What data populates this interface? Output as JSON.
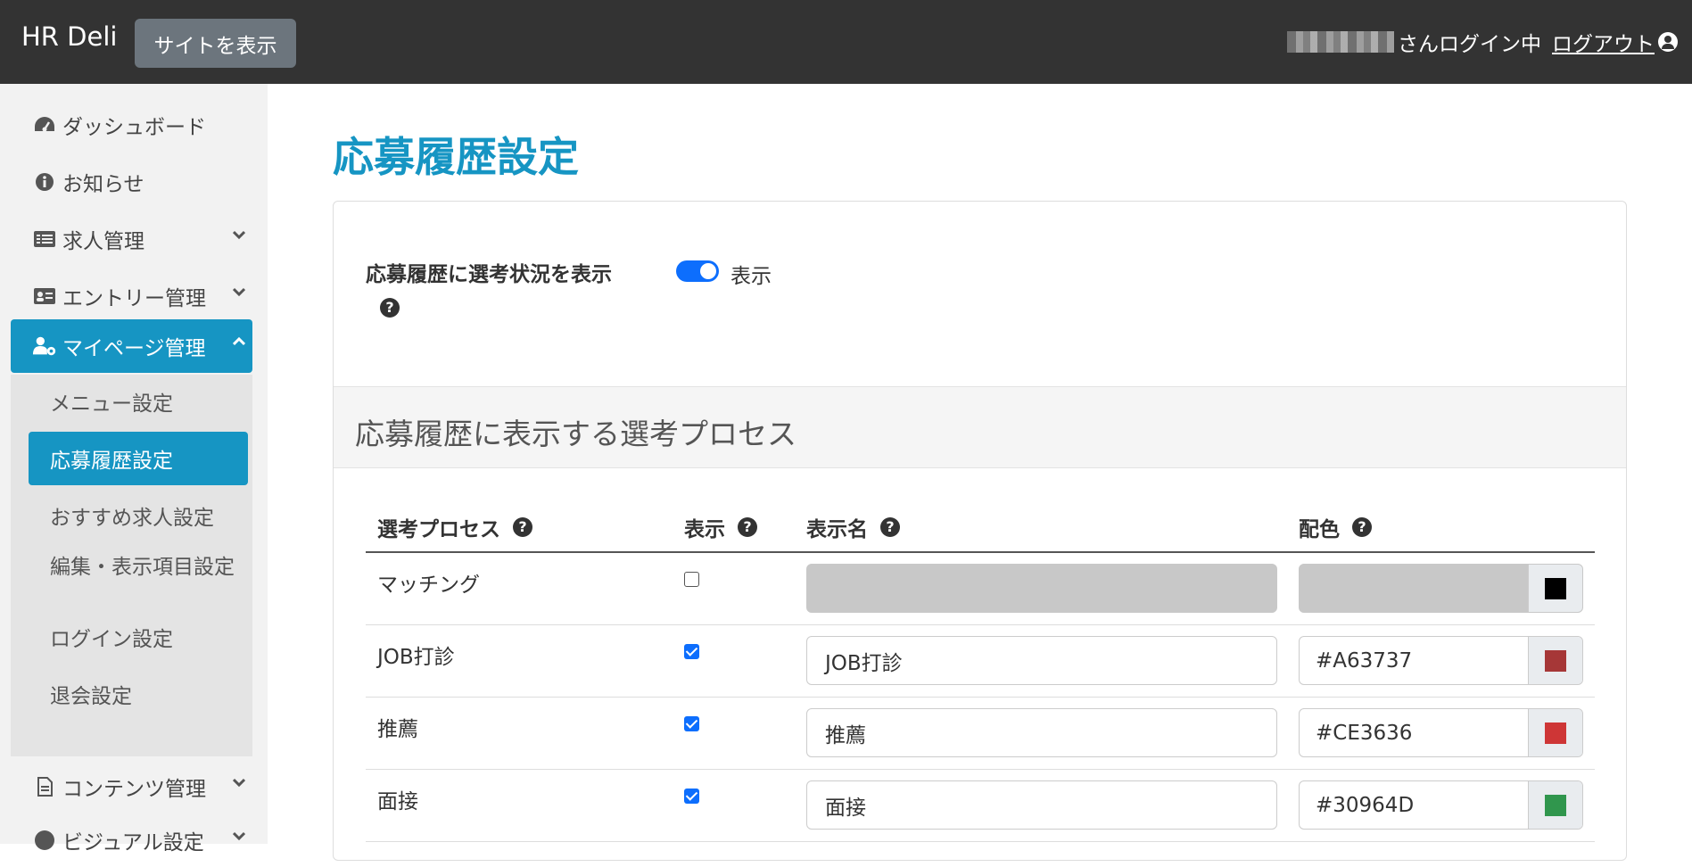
{
  "header": {
    "brand": "HR Deli",
    "site_button": "サイトを表示",
    "login_status": "さんログイン中",
    "logout": "ログアウト"
  },
  "sidebar": {
    "items": [
      {
        "label": "ダッシュボード",
        "icon": "gauge-icon"
      },
      {
        "label": "お知らせ",
        "icon": "info-icon"
      },
      {
        "label": "求人管理",
        "icon": "list-icon"
      },
      {
        "label": "エントリー管理",
        "icon": "id-card-icon"
      },
      {
        "label": "マイページ管理",
        "icon": "user-gear-icon"
      },
      {
        "label": "コンテンツ管理",
        "icon": "file-icon"
      },
      {
        "label": "ビジュアル設定",
        "icon": "palette-icon"
      }
    ],
    "sub_items": [
      {
        "label": "メニュー設定"
      },
      {
        "label": "応募履歴設定"
      },
      {
        "label": "おすすめ求人設定"
      },
      {
        "label": "編集・表示項目設定"
      },
      {
        "label": "ログイン設定"
      },
      {
        "label": "退会設定"
      }
    ]
  },
  "page": {
    "title": "応募履歴設定",
    "setting_label": "応募履歴に選考状況を表示",
    "toggle_label": "表示",
    "toggle_on": true,
    "section_title": "応募履歴に表示する選考プロセス"
  },
  "table": {
    "headers": [
      "選考プロセス",
      "表示",
      "表示名",
      "配色"
    ],
    "rows": [
      {
        "process": "マッチング",
        "shown": false,
        "display_name": "",
        "color": "",
        "swatch": "#000000"
      },
      {
        "process": "JOB打診",
        "shown": true,
        "display_name": "JOB打診",
        "color": "#A63737",
        "swatch": "#A63737"
      },
      {
        "process": "推薦",
        "shown": true,
        "display_name": "推薦",
        "color": "#CE3636",
        "swatch": "#CE3636"
      },
      {
        "process": "面接",
        "shown": true,
        "display_name": "面接",
        "color": "#30964D",
        "swatch": "#30964D"
      }
    ]
  },
  "colors": {
    "accent": "#1695C3",
    "topbar": "#333333",
    "toggle": "#0D6EFD"
  }
}
